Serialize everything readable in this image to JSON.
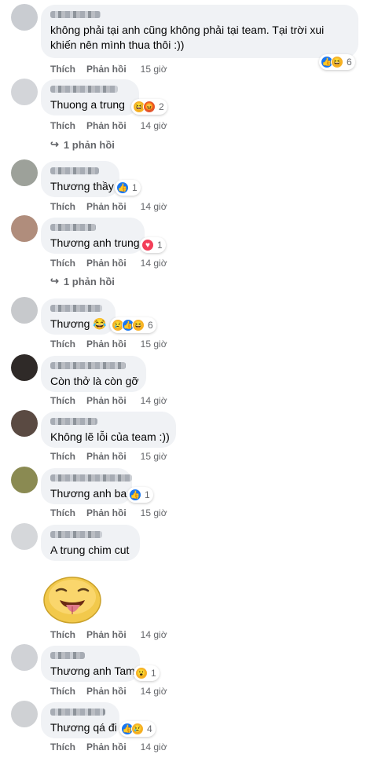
{
  "labels": {
    "like": "Thích",
    "reply": "Phản hồi",
    "replies": "1 phản hồi"
  },
  "comments": [
    {
      "text": "không phải tại anh cũng không phải tại team. Tại trời xui khiến nên mình thua thôi :))",
      "time": "15 giờ",
      "reaction_count": "6",
      "reactions": [
        "like",
        "haha"
      ]
    },
    {
      "text": "Thuong a trung",
      "time": "14 giờ",
      "reaction_count": "2",
      "reactions": [
        "haha",
        "angry"
      ],
      "replies": "1 phản hồi"
    },
    {
      "text": "Thương thầy",
      "time": "14 giờ",
      "reaction_count": "1",
      "reactions": [
        "like"
      ]
    },
    {
      "text": "Thương anh trung",
      "time": "14 giờ",
      "reaction_count": "1",
      "reactions": [
        "love"
      ],
      "replies": "1 phản hồi"
    },
    {
      "text": "Thương 😂",
      "time": "15 giờ",
      "reaction_count": "6",
      "reactions": [
        "sad",
        "like",
        "haha"
      ]
    },
    {
      "text": "Còn thở là còn gỡ",
      "time": "14 giờ"
    },
    {
      "text": "Không lẽ lỗi của team :))",
      "time": "15 giờ"
    },
    {
      "text": "Thương anh ba",
      "time": "15 giờ",
      "reaction_count": "1",
      "reactions": [
        "like"
      ]
    },
    {
      "text": "A trung chim cut",
      "time": "14 giờ",
      "sticker": "tongue-out-face-sticker"
    },
    {
      "text": "Thương anh Tam",
      "time": "14 giờ",
      "reaction_count": "1",
      "reactions": [
        "wow"
      ]
    },
    {
      "text": "Thương qá đi",
      "time": "14 giờ",
      "reaction_count": "4",
      "reactions": [
        "like",
        "sad"
      ]
    }
  ],
  "colors": {
    "like": "#1877f2",
    "haha": "#f7b125",
    "angry": "#e4572e",
    "love": "#f33e58",
    "bubble": "#f0f2f5",
    "meta": "#65676b"
  }
}
